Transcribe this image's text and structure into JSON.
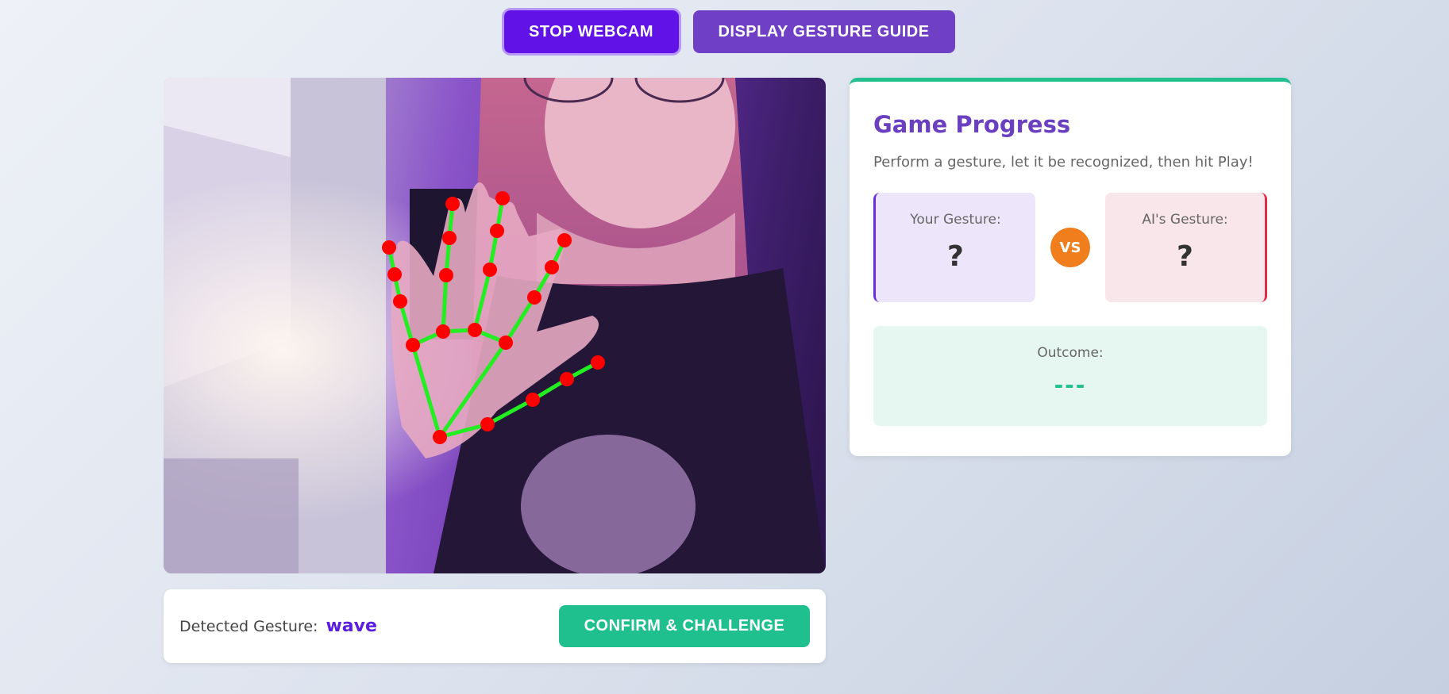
{
  "toolbar": {
    "stop_webcam_label": "STOP WEBCAM",
    "display_guide_label": "DISPLAY GESTURE GUIDE"
  },
  "webcam": {
    "feed_description": "webcam-feed",
    "landmark_color": "#ff0000",
    "connection_color": "#22ee22"
  },
  "detected": {
    "label": "Detected Gesture:",
    "value": "wave",
    "confirm_label": "CONFIRM & CHALLENGE"
  },
  "game": {
    "title": "Game Progress",
    "subtitle": "Perform a gesture, let it be recognized, then hit Play!",
    "your_label": "Your Gesture:",
    "your_value": "?",
    "vs_label": "VS",
    "ai_label": "AI's Gesture:",
    "ai_value": "?",
    "outcome_label": "Outcome:",
    "outcome_value": "---"
  },
  "colors": {
    "accent_purple": "#6112e6",
    "accent_green": "#20c08e",
    "vs_orange": "#f07e1c",
    "ai_red": "#dd2c45"
  }
}
